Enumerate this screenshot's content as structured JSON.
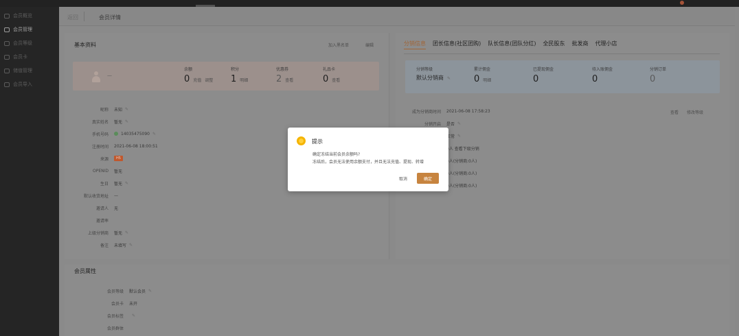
{
  "sidebar": {
    "items": [
      {
        "label": "会员概览",
        "icon": "dashboard-icon",
        "active": false
      },
      {
        "label": "会员管理",
        "icon": "users-icon",
        "active": true
      },
      {
        "label": "会员等级",
        "icon": "level-icon",
        "active": false
      },
      {
        "label": "会员卡",
        "icon": "card-icon",
        "active": false
      },
      {
        "label": "储值管理",
        "icon": "wallet-icon",
        "active": false
      },
      {
        "label": "会员导入",
        "icon": "import-icon",
        "active": false
      }
    ]
  },
  "breadcrumb": {
    "back": "返回",
    "title": "会员详情"
  },
  "basic": {
    "title": "基本资料",
    "links": {
      "blacklist": "加入黑名单",
      "edit": "编辑"
    },
    "name": "—",
    "stats": [
      {
        "label": "余额",
        "value": "0",
        "unit": "充值",
        "extra": "调整"
      },
      {
        "label": "积分",
        "value": "1",
        "unit": "明细"
      },
      {
        "label": "优惠券",
        "value": "2",
        "unit": "查看"
      },
      {
        "label": "礼品卡",
        "value": "0",
        "unit": "查看"
      }
    ],
    "fields": [
      {
        "label": "昵称",
        "value": "未知"
      },
      {
        "label": "真实姓名",
        "value": "暂无"
      },
      {
        "label": "手机号码",
        "value": "14035475090"
      },
      {
        "label": "注册时间",
        "value": "2021-06-08 18:00:51"
      },
      {
        "label": "来源",
        "value": "H5"
      },
      {
        "label": "OPENID",
        "value": "暂无"
      },
      {
        "label": "生日",
        "value": "暂无"
      },
      {
        "label": "默认收货地址",
        "value": "—"
      },
      {
        "label": "邀请人",
        "value": "无"
      },
      {
        "label": "邀请率",
        "value": ""
      },
      {
        "label": "上级分销商",
        "value": "暂无"
      },
      {
        "label": "备注",
        "value": "未填写"
      }
    ]
  },
  "distribution": {
    "tabs": [
      "分销信息",
      "团长信息(社区团购)",
      "队长信息(团队分红)",
      "全民股东",
      "批发商",
      "代理小店"
    ],
    "active_tab": 0,
    "stats": [
      {
        "label": "分销等级",
        "value": "默认分销商"
      },
      {
        "label": "累计佣金",
        "value": "0",
        "unit": "明细"
      },
      {
        "label": "已提现佣金",
        "value": "0"
      },
      {
        "label": "待入账佣金",
        "value": "0"
      },
      {
        "label": "分销订单",
        "value": "0"
      }
    ],
    "rows": [
      {
        "label": "成为分销商时间",
        "value": "2021-06-08 17:58:23"
      },
      {
        "label": "分销开启",
        "value": "是否"
      },
      {
        "label": "",
        "value": "正常"
      },
      {
        "label": "",
        "value": "0人 查看下级分销"
      },
      {
        "label": "",
        "value": "0人(分销商:0人)"
      },
      {
        "label": "",
        "value": "0人(分销商:0人)"
      },
      {
        "label": "",
        "value": "0人(分销商:0人)"
      }
    ],
    "links": {
      "view": "查看",
      "modify": "修改等级"
    }
  },
  "attributes": {
    "title": "会员属性",
    "fields": [
      {
        "label": "会员等级",
        "value": "默认会员"
      },
      {
        "label": "会员卡",
        "value": "未开"
      },
      {
        "label": "会员标签",
        "value": ""
      },
      {
        "label": "会员群体",
        "value": ""
      }
    ]
  },
  "modal": {
    "title": "提示",
    "line1": "确定冻结当前会员余额吗?",
    "line2": "冻结后，会员无法使用余额支付，并且无法充值、提现、转增",
    "cancel": "取消",
    "confirm": "确定"
  }
}
